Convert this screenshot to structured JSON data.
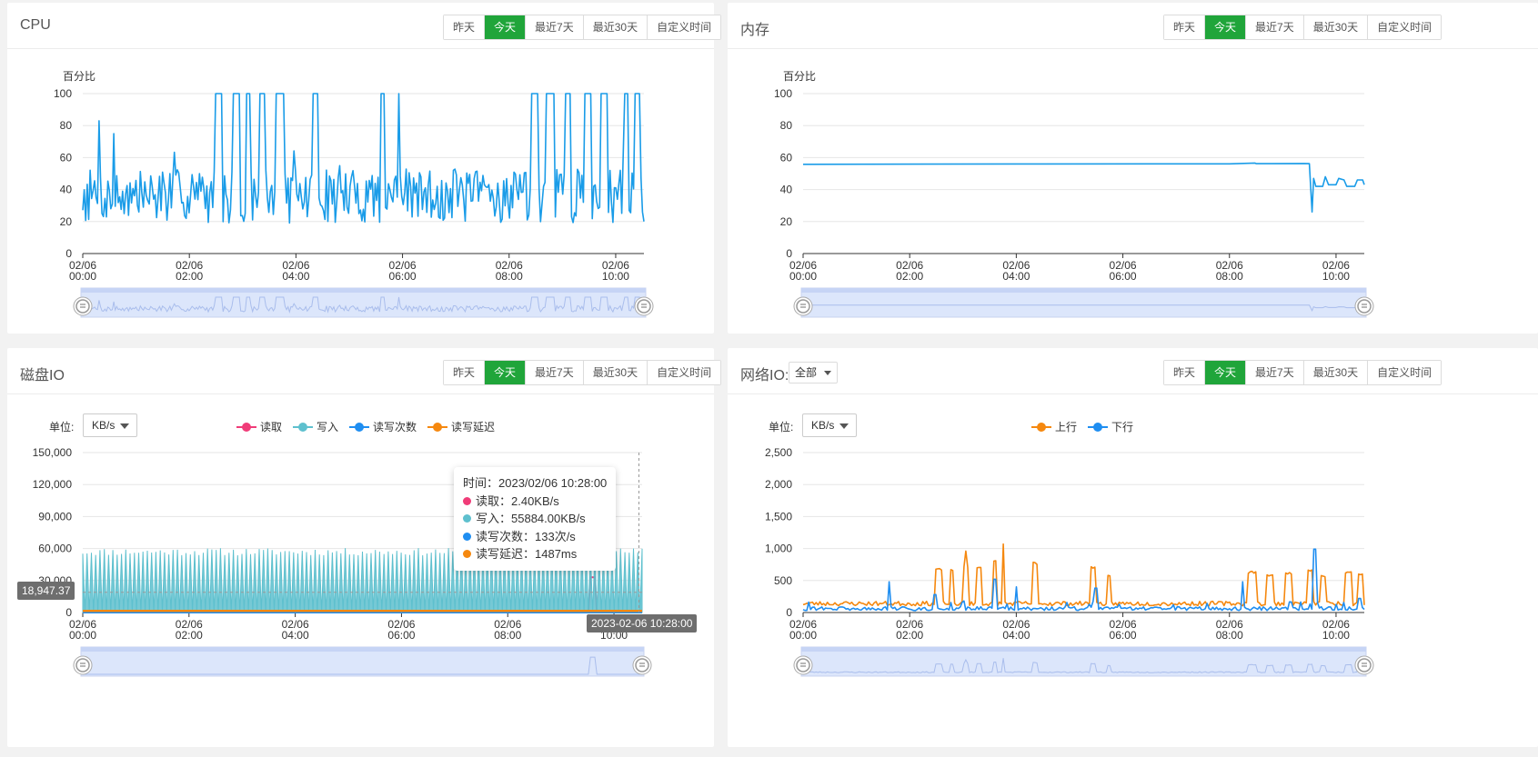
{
  "range_buttons": [
    "昨天",
    "今天",
    "最近7天",
    "最近30天",
    "自定义时间"
  ],
  "active_range": "今天",
  "panels": {
    "cpu": {
      "title": "CPU"
    },
    "memory": {
      "title": "内存"
    },
    "disk": {
      "title": "磁盘IO",
      "unit_label": "单位:",
      "unit_value": "KB/s"
    },
    "network": {
      "title": "网络IO:",
      "interface_value": "全部",
      "unit_label": "单位:",
      "unit_value": "KB/s"
    }
  },
  "disk_tooltip": {
    "time": "时间：2023/02/06 10:28:00",
    "rows": [
      {
        "text": "读取：2.40KB/s",
        "color": "#f03c78"
      },
      {
        "text": "写入：55884.00KB/s",
        "color": "#5ec0ce"
      },
      {
        "text": "读写次数：133次/s",
        "color": "#1f8ef1"
      },
      {
        "text": "读写延迟：1487ms",
        "color": "#f5880f"
      }
    ]
  },
  "disk_axis_pointer": {
    "y_value": "18,947.37",
    "x_value": "2023-02-06 10:28:00"
  },
  "colors": {
    "accent": "#20a53a",
    "cpu_line": "#1a9ce8",
    "read": "#f03c78",
    "write": "#5ec0ce",
    "iops": "#1f8ef1",
    "latency": "#f5880f",
    "up": "#f5880f",
    "down": "#1f8ef1"
  },
  "chart_data": [
    {
      "id": "cpu",
      "type": "line",
      "ylabel": "百分比",
      "ylim": [
        0,
        100
      ],
      "yticks": [
        "0",
        "20",
        "40",
        "60",
        "80",
        "100"
      ],
      "xticks": [
        [
          "02/06",
          "00:00"
        ],
        [
          "02/06",
          "02:00"
        ],
        [
          "02/06",
          "04:00"
        ],
        [
          "02/06",
          "06:00"
        ],
        [
          "02/06",
          "08:00"
        ],
        [
          "02/06",
          "10:00"
        ]
      ],
      "x_range_hours": [
        0,
        10.53
      ],
      "series": [
        {
          "color": "#1a9ce8",
          "pattern": "cpu",
          "baseline": 36,
          "spikes_to_100_hours": [
            [
              2.48,
              2.62
            ],
            [
              2.8,
              2.95
            ],
            [
              3.05,
              3.15
            ],
            [
              3.3,
              3.42
            ],
            [
              3.62,
              3.78
            ],
            [
              4.3,
              4.43
            ],
            [
              5.58,
              5.68
            ],
            [
              8.4,
              8.55
            ],
            [
              8.7,
              8.85
            ],
            [
              9.05,
              9.15
            ],
            [
              9.42,
              9.55
            ],
            [
              9.72,
              9.86
            ],
            [
              10.15,
              10.25
            ],
            [
              10.35,
              10.45
            ]
          ],
          "notable_peaks_hours": [
            [
              0.3,
              83
            ],
            [
              0.58,
              75
            ],
            [
              5.92,
              100
            ]
          ]
        }
      ]
    },
    {
      "id": "memory",
      "type": "line",
      "ylabel": "百分比",
      "ylim": [
        0,
        100
      ],
      "yticks": [
        "0",
        "20",
        "40",
        "60",
        "80",
        "100"
      ],
      "xticks": [
        [
          "02/06",
          "00:00"
        ],
        [
          "02/06",
          "02:00"
        ],
        [
          "02/06",
          "04:00"
        ],
        [
          "02/06",
          "06:00"
        ],
        [
          "02/06",
          "08:00"
        ],
        [
          "02/06",
          "10:00"
        ]
      ],
      "x_range_hours": [
        0,
        10.53
      ],
      "series": [
        {
          "color": "#1a9ce8",
          "pattern": "memory",
          "points_hours": [
            [
              0,
              55.8
            ],
            [
              4,
              56.0
            ],
            [
              8,
              56.1
            ],
            [
              8.48,
              56.6
            ],
            [
              8.5,
              56.2
            ],
            [
              9.4,
              56.3
            ],
            [
              9.5,
              56.2
            ],
            [
              9.55,
              26
            ],
            [
              9.58,
              47
            ],
            [
              9.62,
              42
            ],
            [
              9.75,
              42
            ],
            [
              9.8,
              48
            ],
            [
              9.86,
              43
            ],
            [
              10.0,
              43
            ],
            [
              10.05,
              47
            ],
            [
              10.15,
              46
            ],
            [
              10.2,
              42
            ],
            [
              10.35,
              42
            ],
            [
              10.4,
              46
            ],
            [
              10.5,
              46
            ],
            [
              10.53,
              43
            ]
          ]
        }
      ]
    },
    {
      "id": "disk",
      "type": "bar+line",
      "ylim": [
        0,
        150000
      ],
      "yticks": [
        "0",
        "30,000",
        "60,000",
        "90,000",
        "120,000",
        "150,000"
      ],
      "xticks": [
        [
          "02/06",
          "00:00"
        ],
        [
          "02/06",
          "02:00"
        ],
        [
          "02/06",
          "04:00"
        ],
        [
          "02/06",
          "06:00"
        ],
        [
          "02/06",
          "08:00"
        ],
        [
          "02/06",
          "10:00"
        ]
      ],
      "x_range_hours": [
        0,
        10.53
      ],
      "series": [
        {
          "name": "读取",
          "color": "#f03c78",
          "pattern": "disk_read",
          "spike_hours": 9.6,
          "spike_value": 33000
        },
        {
          "name": "写入",
          "color": "#5ec0ce",
          "pattern": "disk_write",
          "high": 57000,
          "low": 0
        },
        {
          "name": "读写次数",
          "color": "#1f8ef1",
          "pattern": "flat",
          "value": 133
        },
        {
          "name": "读写延迟",
          "color": "#f5880f",
          "pattern": "flat",
          "value": 1487
        }
      ]
    },
    {
      "id": "network",
      "type": "line",
      "ylim": [
        0,
        2500
      ],
      "yticks": [
        "0",
        "500",
        "1,000",
        "1,500",
        "2,000",
        "2,500"
      ],
      "xticks": [
        [
          "02/06",
          "00:00"
        ],
        [
          "02/06",
          "02:00"
        ],
        [
          "02/06",
          "04:00"
        ],
        [
          "02/06",
          "06:00"
        ],
        [
          "02/06",
          "08:00"
        ],
        [
          "02/06",
          "10:00"
        ]
      ],
      "x_range_hours": [
        0,
        10.53
      ],
      "series": [
        {
          "name": "上行",
          "color": "#f5880f",
          "pattern": "net_up",
          "baseline": 140,
          "plateaus_hours": [
            [
              2.48,
              2.6,
              680
            ],
            [
              2.75,
              2.82,
              650
            ],
            [
              3.0,
              3.12,
              700
            ],
            [
              3.25,
              3.35,
              700
            ],
            [
              3.55,
              3.65,
              800
            ],
            [
              4.3,
              4.4,
              770
            ],
            [
              5.4,
              5.5,
              700
            ],
            [
              5.7,
              5.78,
              560
            ],
            [
              8.35,
              8.5,
              630
            ],
            [
              8.7,
              8.82,
              580
            ],
            [
              9.05,
              9.18,
              620
            ],
            [
              9.45,
              9.55,
              650
            ],
            [
              9.7,
              9.82,
              570
            ],
            [
              10.15,
              10.3,
              630
            ],
            [
              10.4,
              10.5,
              600
            ]
          ],
          "peaks_hours": [
            [
              3.05,
              960
            ],
            [
              3.75,
              1070
            ]
          ]
        },
        {
          "name": "下行",
          "color": "#1f8ef1",
          "pattern": "net_down",
          "baseline": 60,
          "peaks_hours": [
            [
              1.62,
              480
            ],
            [
              2.47,
              280
            ],
            [
              3.6,
              520
            ],
            [
              4.0,
              400
            ],
            [
              5.5,
              380
            ],
            [
              8.25,
              480
            ],
            [
              9.6,
              990
            ],
            [
              10.45,
              220
            ]
          ]
        }
      ]
    }
  ]
}
